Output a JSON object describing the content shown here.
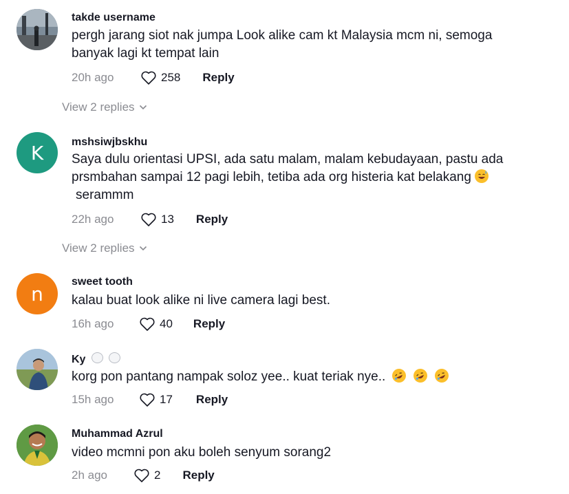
{
  "comments": [
    {
      "username": "takde username",
      "text": "pergh jarang siot nak jumpa Look alike cam kt Malaysia mcm ni, semoga banyak lagi kt tempat lain",
      "time": "20h ago",
      "likes": "258",
      "reply_label": "Reply",
      "view_replies": "View 2 replies",
      "avatar": "photo"
    },
    {
      "username": "mshsiwjbskhu",
      "text": "Saya dulu orientasi UPSI, ada satu malam, malam kebudayaan, pastu ada prsmbahan sampai 12 pagi lebih, tetiba ada org histeria kat belakang",
      "text_suffix": "serammm",
      "emoji": "grinning-sweat-emoji",
      "time": "22h ago",
      "likes": "13",
      "reply_label": "Reply",
      "view_replies": "View 2 replies",
      "avatar_letter": "K",
      "avatar_color": "#1e9a80"
    },
    {
      "username": "sweet tooth",
      "text": "kalau buat look alike ni live camera lagi best.",
      "time": "16h ago",
      "likes": "40",
      "reply_label": "Reply",
      "avatar_letter": "n",
      "avatar_color": "#f27d12"
    },
    {
      "username": "Ky",
      "username_emoji": "polar-bear-emoji",
      "text": "korg pon pantang nampak soloz yee.. kuat teriak nye..",
      "emoji": "rofl-emoji",
      "time": "15h ago",
      "likes": "17",
      "reply_label": "Reply",
      "avatar": "photo"
    },
    {
      "username": "Muhammad Azrul",
      "text": "video mcmni pon aku boleh senyum sorang2",
      "time": "2h ago",
      "likes": "2",
      "reply_label": "Reply",
      "avatar": "photo"
    }
  ],
  "colors": {
    "text": "#161823",
    "muted": "#8a8b91",
    "emoji": "#fbbf2b"
  }
}
